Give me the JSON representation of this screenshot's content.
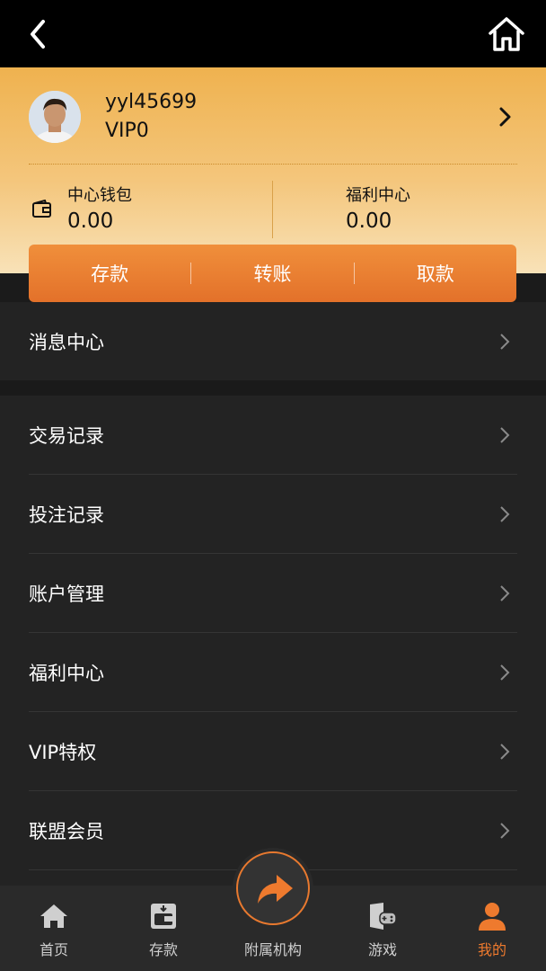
{
  "header": {
    "back_icon": "chevron-left-icon",
    "home_icon": "home-icon"
  },
  "profile": {
    "username": "yyl45699",
    "vip_level": "VIP0",
    "wallet_label": "中心钱包",
    "wallet_value": "0.00",
    "welfare_label": "福利中心",
    "welfare_value": "0.00"
  },
  "actions": {
    "deposit": "存款",
    "transfer": "转账",
    "withdraw": "取款"
  },
  "menu_top": {
    "label": "消息中心"
  },
  "menu": [
    {
      "label": "交易记录"
    },
    {
      "label": "投注记录"
    },
    {
      "label": "账户管理"
    },
    {
      "label": "福利中心"
    },
    {
      "label": "VIP特权"
    },
    {
      "label": "联盟会员"
    }
  ],
  "tabbar": {
    "home": "首页",
    "deposit": "存款",
    "affiliate": "附属机构",
    "games": "游戏",
    "mine": "我的"
  },
  "colors": {
    "accent": "#ee7a2e",
    "header_gold": "#efb24f",
    "background": "#232323"
  }
}
